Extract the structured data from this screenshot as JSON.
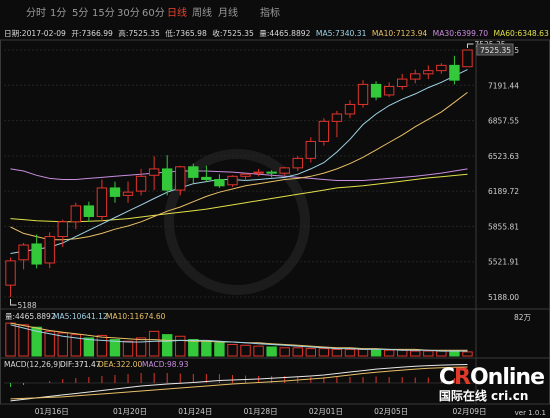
{
  "tabs": [
    {
      "label": "分时",
      "active": false
    },
    {
      "label": "1分",
      "active": false
    },
    {
      "label": "5分",
      "active": false
    },
    {
      "label": "15分",
      "active": false
    },
    {
      "label": "30分",
      "active": false
    },
    {
      "label": "60分",
      "active": false
    },
    {
      "label": "日线",
      "active": true
    },
    {
      "label": "周线",
      "active": false
    },
    {
      "label": "月线",
      "active": false
    },
    {
      "label": "指标",
      "active": false
    }
  ],
  "info": {
    "date": "日期:2017-02-09",
    "open": "开:7366.99",
    "high": "高:7525.35",
    "low": "低:7365.98",
    "close": "收:7525.35",
    "vol": "量:4465.8892",
    "ma5": "MA5:7340.31",
    "ma10": "MA10:7123.94",
    "ma30": "MA30:6399.70",
    "ma60": "MA60:6348.63"
  },
  "colors": {
    "up": "#e0342c",
    "down": "#34c93a",
    "ma5": "#9fd3e6",
    "ma10": "#e8c066",
    "ma30": "#c98de0",
    "ma60": "#e0e04a",
    "active_tab": "#e8452f"
  },
  "main_axis_labels": [
    "7525.35",
    "7191.44",
    "6857.55",
    "6523.63",
    "6189.72",
    "5855.81",
    "5521.91",
    "5188.00"
  ],
  "last_price_label": "7525.35",
  "high_marker": "7525.35",
  "low_marker": "5188",
  "volume": {
    "vol": "量:4465.8892",
    "ma5": "MA5:10641.12",
    "ma10": "MA10:11674.60",
    "axis_label": "82万"
  },
  "macd": {
    "name": "MACD(12,26,9)",
    "dif": "DIF:371.47",
    "dea": "DEA:322.00",
    "macd": "MACD:98.93"
  },
  "x_labels": [
    "01月16日",
    "01月20日",
    "01月24日",
    "01月28日",
    "02月01日",
    "02月05日",
    "02月09日"
  ],
  "watermark": {
    "brand_pre": "C",
    "brand_r": "R",
    "brand_post": "Online",
    "sub": "国际在线 cri.cn"
  },
  "version": "ver 1.0.1",
  "chart_data": {
    "type": "candlestick",
    "ylim": [
      5188,
      7525.35
    ],
    "candles": [
      {
        "o": 5300,
        "h": 5560,
        "l": 5188,
        "c": 5530
      },
      {
        "o": 5540,
        "h": 5700,
        "l": 5450,
        "c": 5680
      },
      {
        "o": 5690,
        "h": 5780,
        "l": 5460,
        "c": 5500
      },
      {
        "o": 5510,
        "h": 5800,
        "l": 5460,
        "c": 5760
      },
      {
        "o": 5760,
        "h": 5920,
        "l": 5660,
        "c": 5900
      },
      {
        "o": 5900,
        "h": 6080,
        "l": 5830,
        "c": 6050
      },
      {
        "o": 6050,
        "h": 6090,
        "l": 5900,
        "c": 5950
      },
      {
        "o": 5950,
        "h": 6300,
        "l": 5900,
        "c": 6220
      },
      {
        "o": 6220,
        "h": 6280,
        "l": 6080,
        "c": 6140
      },
      {
        "o": 6150,
        "h": 6280,
        "l": 6080,
        "c": 6180
      },
      {
        "o": 6190,
        "h": 6400,
        "l": 6150,
        "c": 6330
      },
      {
        "o": 6340,
        "h": 6520,
        "l": 6200,
        "c": 6400
      },
      {
        "o": 6400,
        "h": 6530,
        "l": 6150,
        "c": 6200
      },
      {
        "o": 6200,
        "h": 6430,
        "l": 6150,
        "c": 6420
      },
      {
        "o": 6420,
        "h": 6450,
        "l": 6260,
        "c": 6320
      },
      {
        "o": 6320,
        "h": 6430,
        "l": 6280,
        "c": 6300
      },
      {
        "o": 6300,
        "h": 6350,
        "l": 6220,
        "c": 6240
      },
      {
        "o": 6250,
        "h": 6340,
        "l": 6230,
        "c": 6330
      },
      {
        "o": 6330,
        "h": 6360,
        "l": 6290,
        "c": 6350
      },
      {
        "o": 6360,
        "h": 6400,
        "l": 6330,
        "c": 6370
      },
      {
        "o": 6370,
        "h": 6390,
        "l": 6320,
        "c": 6360
      },
      {
        "o": 6360,
        "h": 6420,
        "l": 6340,
        "c": 6410
      },
      {
        "o": 6410,
        "h": 6520,
        "l": 6380,
        "c": 6500
      },
      {
        "o": 6500,
        "h": 6700,
        "l": 6460,
        "c": 6660
      },
      {
        "o": 6660,
        "h": 6880,
        "l": 6620,
        "c": 6850
      },
      {
        "o": 6850,
        "h": 6950,
        "l": 6700,
        "c": 6920
      },
      {
        "o": 6920,
        "h": 7050,
        "l": 6880,
        "c": 7010
      },
      {
        "o": 7010,
        "h": 7240,
        "l": 6980,
        "c": 7200
      },
      {
        "o": 7200,
        "h": 7230,
        "l": 7050,
        "c": 7080
      },
      {
        "o": 7100,
        "h": 7220,
        "l": 7080,
        "c": 7180
      },
      {
        "o": 7180,
        "h": 7300,
        "l": 7150,
        "c": 7250
      },
      {
        "o": 7250,
        "h": 7340,
        "l": 7210,
        "c": 7300
      },
      {
        "o": 7300,
        "h": 7380,
        "l": 7250,
        "c": 7330
      },
      {
        "o": 7330,
        "h": 7400,
        "l": 7300,
        "c": 7380
      },
      {
        "o": 7380,
        "h": 7470,
        "l": 7200,
        "c": 7240
      },
      {
        "o": 7366.99,
        "h": 7525.35,
        "l": 7365.98,
        "c": 7525.35
      }
    ],
    "ma5": [
      5600,
      5620,
      5640,
      5660,
      5700,
      5760,
      5820,
      5880,
      5940,
      6000,
      6060,
      6120,
      6180,
      6220,
      6260,
      6280,
      6300,
      6300,
      6290,
      6300,
      6310,
      6320,
      6350,
      6400,
      6460,
      6560,
      6680,
      6820,
      6920,
      7000,
      7060,
      7110,
      7170,
      7220,
      7280,
      7340
    ],
    "ma10": [
      5850,
      5790,
      5760,
      5730,
      5730,
      5740,
      5760,
      5790,
      5830,
      5860,
      5900,
      5950,
      6000,
      6040,
      6090,
      6140,
      6180,
      6210,
      6240,
      6260,
      6280,
      6300,
      6310,
      6330,
      6360,
      6400,
      6450,
      6510,
      6580,
      6650,
      6720,
      6800,
      6870,
      6940,
      7030,
      7124
    ],
    "ma30": [
      6400,
      6380,
      6340,
      6310,
      6300,
      6300,
      6310,
      6320,
      6330,
      6340,
      6350,
      6360,
      6370,
      6380,
      6380,
      6380,
      6375,
      6370,
      6360,
      6350,
      6340,
      6330,
      6320,
      6310,
      6300,
      6290,
      6290,
      6290,
      6300,
      6310,
      6320,
      6330,
      6345,
      6360,
      6380,
      6400
    ],
    "ma60": [
      5930,
      5920,
      5910,
      5905,
      5900,
      5900,
      5905,
      5910,
      5920,
      5930,
      5945,
      5960,
      5975,
      5990,
      6005,
      6020,
      6040,
      6060,
      6080,
      6100,
      6120,
      6140,
      6160,
      6180,
      6200,
      6220,
      6230,
      6240,
      6255,
      6270,
      6285,
      6300,
      6315,
      6325,
      6338,
      6349
    ],
    "volume": [
      40,
      38,
      35,
      30,
      28,
      26,
      22,
      25,
      20,
      18,
      22,
      30,
      26,
      24,
      20,
      18,
      16,
      14,
      13,
      12,
      11,
      10,
      10,
      9,
      9,
      8,
      8,
      8,
      7,
      7,
      7,
      6,
      6,
      6,
      6,
      5
    ],
    "volume_ma5": [
      38,
      34,
      30,
      27,
      24,
      22,
      20,
      19,
      18,
      17,
      17,
      18,
      18,
      19,
      19,
      19,
      18,
      17,
      16,
      15,
      14,
      13,
      12,
      11,
      10,
      9,
      9,
      8,
      8,
      8,
      7,
      7,
      7,
      6,
      6,
      6
    ],
    "volume_ma10": [
      40,
      37,
      34,
      31,
      29,
      27,
      25,
      23,
      22,
      21,
      20,
      20,
      19,
      19,
      18,
      18,
      17,
      17,
      16,
      16,
      15,
      14,
      13,
      12,
      11,
      10,
      10,
      9,
      9,
      8,
      8,
      8,
      7,
      7,
      7,
      7
    ],
    "dif": [
      -360,
      -330,
      -300,
      -270,
      -240,
      -210,
      -180,
      -150,
      -120,
      -90,
      -60,
      -40,
      -20,
      -5,
      10,
      30,
      50,
      60,
      70,
      80,
      95,
      110,
      125,
      140,
      160,
      190,
      220,
      250,
      280,
      300,
      320,
      335,
      350,
      360,
      365,
      371.47
    ],
    "dea": [
      -320,
      -310,
      -300,
      -290,
      -280,
      -260,
      -240,
      -220,
      -200,
      -180,
      -160,
      -140,
      -120,
      -100,
      -80,
      -60,
      -40,
      -20,
      -5,
      10,
      25,
      40,
      60,
      80,
      100,
      130,
      160,
      190,
      215,
      240,
      260,
      280,
      295,
      305,
      315,
      322.0
    ]
  }
}
